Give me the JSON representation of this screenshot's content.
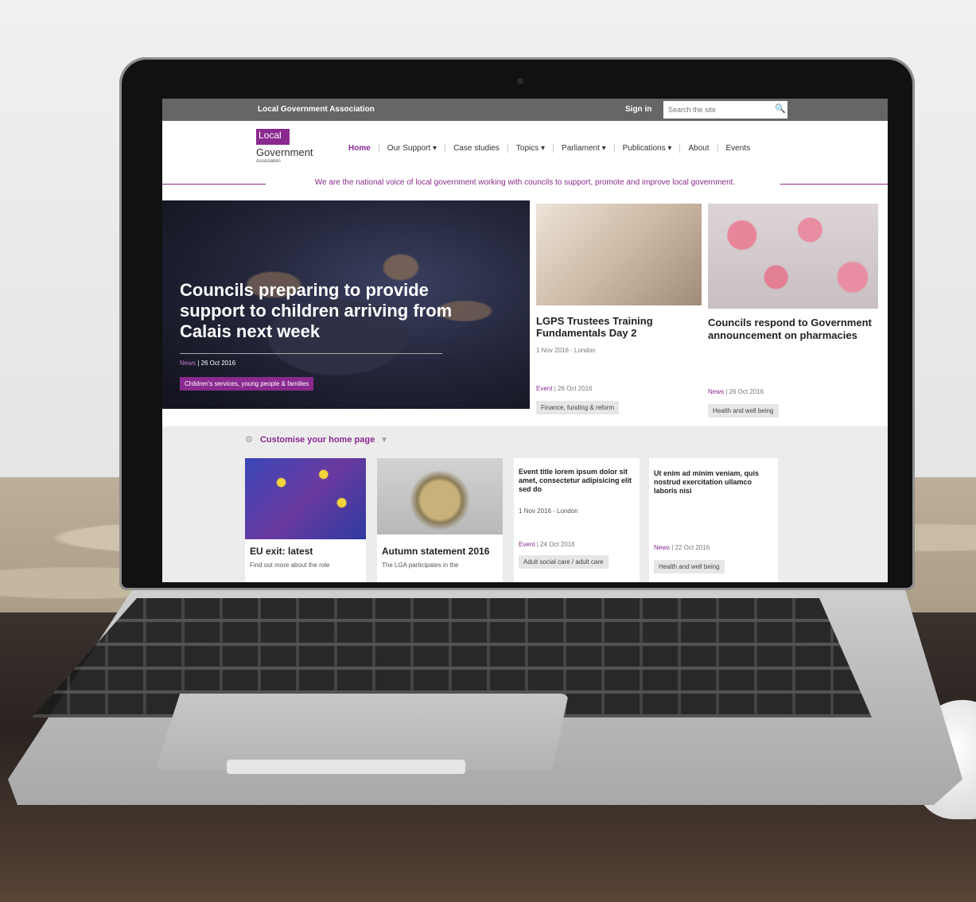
{
  "topbar": {
    "org": "Local Government Association",
    "sign_in": "Sign in",
    "search_placeholder": "Search the site"
  },
  "logo": {
    "line1": "Local",
    "line2": "Government",
    "line3": "Association"
  },
  "nav": {
    "items": [
      {
        "label": "Home"
      },
      {
        "label": "Our Support ▾"
      },
      {
        "label": "Case studies"
      },
      {
        "label": "Topics ▾"
      },
      {
        "label": "Parliament ▾"
      },
      {
        "label": "Publications ▾"
      },
      {
        "label": "About"
      },
      {
        "label": "Events"
      }
    ]
  },
  "tagline": "We are the national voice of local government working with councils to support, promote and improve local government.",
  "hero": {
    "headline": "Councils preparing to provide support to children arriving from Calais next week",
    "type": "News",
    "date": "26 Oct 2016",
    "tag": "Children's services, young people & families"
  },
  "cards": [
    {
      "title": "LGPS Trustees Training Fundamentals Day 2",
      "sub": "1 Nov 2016 - London",
      "type": "Event",
      "date": "26 Oct 2016",
      "tag": "Finance, funding & reform"
    },
    {
      "title": "Councils respond to Government announcement on pharmacies",
      "type": "News",
      "date": "26 Oct 2016",
      "tag": "Health and well being"
    }
  ],
  "customise": {
    "label": "Customise your home page"
  },
  "mini_cards": [
    {
      "title": "EU exit: latest",
      "sub": "Find out more about the role"
    },
    {
      "title": "Autumn statement 2016",
      "sub": "The LGA participates in the"
    },
    {
      "title": "Event title lorem ipsum dolor sit amet, consectetur adipisicing elit sed do",
      "sub": "1 Nov 2016 - London",
      "type": "Event",
      "date": "24 Oct 2016",
      "tag": "Adult social care / adult care"
    },
    {
      "title": "Ut enim ad minim veniam, quis nostrud exercitation ullamco laboris nisi",
      "type": "News",
      "date": "22 Oct 2016",
      "tag": "Health and well being"
    }
  ],
  "colors": {
    "brand": "#8a2a8f",
    "topbar": "#666666"
  },
  "icons": {
    "search": "search-icon",
    "settings": "gear-icon"
  }
}
